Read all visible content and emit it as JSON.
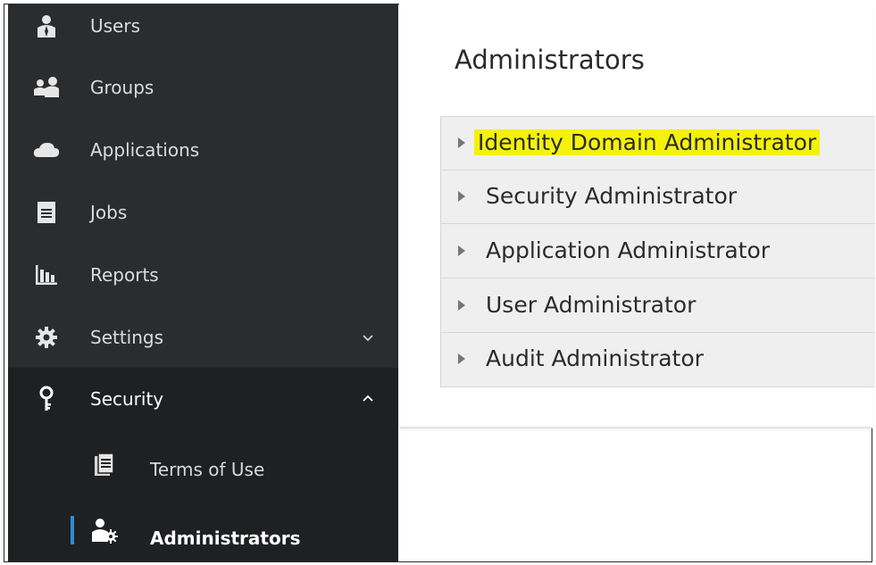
{
  "sidebar": {
    "items": [
      {
        "label": "Users",
        "icon": "user-icon"
      },
      {
        "label": "Groups",
        "icon": "group-icon"
      },
      {
        "label": "Applications",
        "icon": "cloud-icon"
      },
      {
        "label": "Jobs",
        "icon": "jobs-icon"
      },
      {
        "label": "Reports",
        "icon": "bar-chart-icon"
      },
      {
        "label": "Settings",
        "icon": "gear-icon",
        "expanded": false
      },
      {
        "label": "Security",
        "icon": "key-icon",
        "expanded": true
      }
    ],
    "subitems": [
      {
        "label": "Terms of Use",
        "icon": "document-icon"
      },
      {
        "label": "Administrators",
        "icon": "admin-user-gear-icon",
        "current": true
      }
    ]
  },
  "main": {
    "title": "Administrators",
    "roles": [
      {
        "label": "Identity Domain Administrator",
        "highlight": true
      },
      {
        "label": "Security Administrator"
      },
      {
        "label": "Application Administrator"
      },
      {
        "label": "User Administrator"
      },
      {
        "label": "Audit Administrator"
      }
    ]
  },
  "colors": {
    "sidebar_bg": "#2b2c2e",
    "active_bg": "#1f2022",
    "indicator": "#2f8ad8",
    "highlight": "#f4f20a",
    "accordion_bg": "#efefef"
  }
}
